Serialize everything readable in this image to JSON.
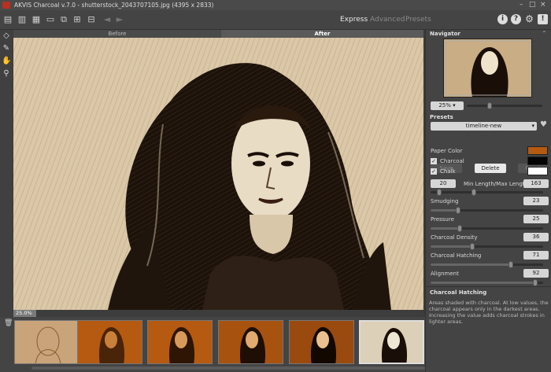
{
  "window": {
    "title": "AKVIS Charcoal v.7.0 - shutterstock_2043707105.jpg (4395 x 2833)",
    "controls": [
      "–",
      "□",
      "×"
    ]
  },
  "toolbar": {
    "modes": [
      "Express",
      "Advanced",
      "Presets"
    ],
    "active_mode": "Express",
    "right_icons": [
      "i",
      "?",
      "⚙",
      "!"
    ]
  },
  "tabs": {
    "before": "Before",
    "after": "After"
  },
  "status": {
    "zoom": "25.0%"
  },
  "navigator": {
    "title": "Navigator",
    "zoom": "25% ▾"
  },
  "presets": {
    "title": "Presets",
    "selected": "timeline-new",
    "save": "Save",
    "delete": "Delete",
    "reset": "Reset"
  },
  "colors": {
    "paper_label": "Paper Color",
    "charcoal_label": "Charcoal",
    "chalk_label": "Chalk",
    "paper": "#b55a10",
    "charcoal": "#050505",
    "chalk": "#ffffff"
  },
  "params": {
    "min_length": "20",
    "length_label": "Min Length/Max Length",
    "max_length": "163",
    "smudging_label": "Smudging",
    "smudging": "23",
    "pressure_label": "Pressure",
    "pressure": "25",
    "density_label": "Charcoal Density",
    "density": "36",
    "hatching_label": "Charcoal Hatching",
    "hatching": "71",
    "alignment_label": "Alignment",
    "alignment": "92"
  },
  "help": {
    "title": "Charcoal Hatching",
    "text": "Areas shaded with charcoal. At low values, the charcoal appears only in the darkest areas. Increasing the value adds charcoal strokes in lighter areas."
  }
}
